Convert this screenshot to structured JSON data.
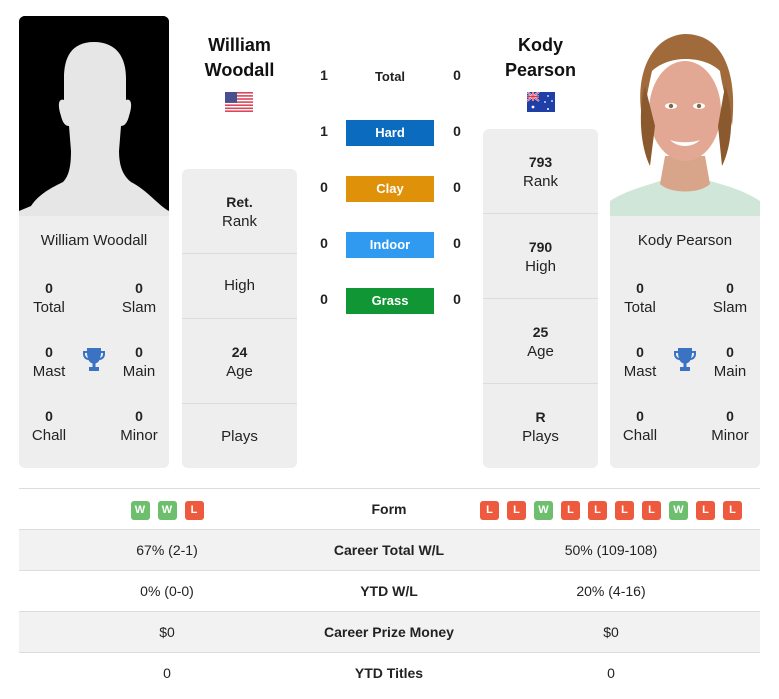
{
  "player1": {
    "name_line1": "William",
    "name_line2": "Woodall",
    "full_name": "William Woodall",
    "country": "USA",
    "flag_icon": "us-flag-icon",
    "photo": "silhouette-placeholder",
    "rank_value": "Ret.",
    "rank_label": "Rank",
    "high_value": "",
    "high_label": "High",
    "age_value": "24",
    "age_label": "Age",
    "plays_value": "",
    "plays_label": "Plays",
    "titles": {
      "total": {
        "value": "0",
        "label": "Total"
      },
      "slam": {
        "value": "0",
        "label": "Slam"
      },
      "mast": {
        "value": "0",
        "label": "Mast"
      },
      "main": {
        "value": "0",
        "label": "Main"
      },
      "chall": {
        "value": "0",
        "label": "Chall"
      },
      "minor": {
        "value": "0",
        "label": "Minor"
      }
    },
    "form": [
      "W",
      "W",
      "L"
    ],
    "career_wl": "67% (2-1)",
    "ytd_wl": "0% (0-0)",
    "prize_money": "$0",
    "ytd_titles": "0"
  },
  "player2": {
    "name_line1": "Kody",
    "name_line2": "Pearson",
    "full_name": "Kody Pearson",
    "country": "Australia",
    "flag_icon": "au-flag-icon",
    "photo": "player-photo",
    "rank_value": "793",
    "rank_label": "Rank",
    "high_value": "790",
    "high_label": "High",
    "age_value": "25",
    "age_label": "Age",
    "plays_value": "R",
    "plays_label": "Plays",
    "titles": {
      "total": {
        "value": "0",
        "label": "Total"
      },
      "slam": {
        "value": "0",
        "label": "Slam"
      },
      "mast": {
        "value": "0",
        "label": "Mast"
      },
      "main": {
        "value": "0",
        "label": "Main"
      },
      "chall": {
        "value": "0",
        "label": "Chall"
      },
      "minor": {
        "value": "0",
        "label": "Minor"
      }
    },
    "form": [
      "L",
      "L",
      "W",
      "L",
      "L",
      "L",
      "L",
      "W",
      "L",
      "L"
    ],
    "career_wl": "50% (109-108)",
    "ytd_wl": "20% (4-16)",
    "prize_money": "$0",
    "ytd_titles": "0"
  },
  "h2h": [
    {
      "label": "Total",
      "p1": "1",
      "p2": "0",
      "color": ""
    },
    {
      "label": "Hard",
      "p1": "1",
      "p2": "0",
      "color": "#0b6bbf"
    },
    {
      "label": "Clay",
      "p1": "0",
      "p2": "0",
      "color": "#e0910a"
    },
    {
      "label": "Indoor",
      "p1": "0",
      "p2": "0",
      "color": "#2f9af0"
    },
    {
      "label": "Grass",
      "p1": "0",
      "p2": "0",
      "color": "#119636"
    }
  ],
  "comparison": {
    "form_label": "Form",
    "career_wl_label": "Career Total W/L",
    "ytd_wl_label": "YTD W/L",
    "prize_label": "Career Prize Money",
    "ytd_titles_label": "YTD Titles"
  },
  "colors": {
    "win": "#6dbf6d",
    "loss": "#ee5a3e",
    "trophy": "#3a72c4"
  }
}
